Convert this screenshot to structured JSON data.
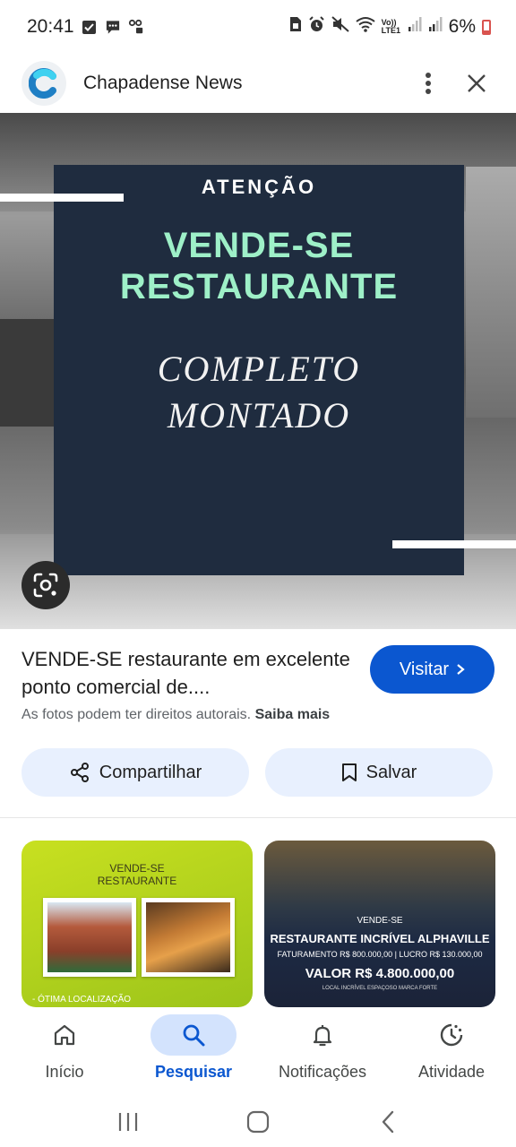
{
  "status_bar": {
    "time": "20:41",
    "battery": "6%",
    "network_label": "Vo)) LTE1",
    "battery_color": "#d9534f"
  },
  "header": {
    "site_name": "Chapadense News",
    "logo_color": "#1f7fc4",
    "more_icon": "more-vert-icon",
    "close_icon": "close-icon"
  },
  "hero": {
    "line1": "ATENÇÃO",
    "line2": "VENDE-SE",
    "line3": "RESTAURANTE",
    "line4": "COMPLETO",
    "line5": "MONTADO",
    "panel_color": "#1f2c3f",
    "headline_color": "#9ef0c8"
  },
  "result": {
    "title": "VENDE-SE restaurante em excelente ponto comercial de....",
    "visit_label": "Visitar",
    "copyright_text": "As fotos podem ter direitos autorais.",
    "learn_more": "Saiba mais",
    "share_label": "Compartilhar",
    "save_label": "Salvar",
    "accent": "#0b57d0"
  },
  "related": [
    {
      "line1": "VENDE-SE",
      "line2": "RESTAURANTE",
      "footer": "- ÓTIMA LOCALIZAÇÃO"
    },
    {
      "line1": "VENDE-SE",
      "line2": "RESTAURANTE INCRÍVEL ALPHAVILLE",
      "line3": "FATURAMENTO R$ 800.000,00 | LUCRO R$ 130.000,00",
      "line4": "VALOR R$ 4.800.000,00",
      "line5": "LOCAL INCRÍVEL ESPAÇOSO MARCA FORTE"
    }
  ],
  "bottom_nav": [
    {
      "label": "Início",
      "icon": "home-icon",
      "active": false
    },
    {
      "label": "Pesquisar",
      "icon": "search-icon",
      "active": true
    },
    {
      "label": "Notificações",
      "icon": "bell-icon",
      "active": false
    },
    {
      "label": "Atividade",
      "icon": "activity-icon",
      "active": false
    }
  ]
}
